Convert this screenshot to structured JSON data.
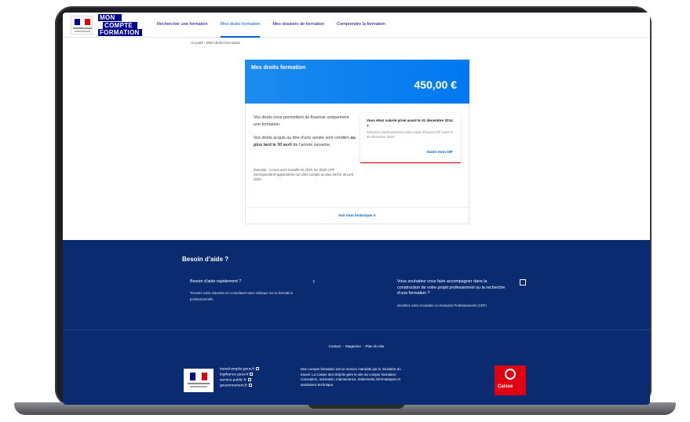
{
  "colors": {
    "brand_blue": "#000091",
    "link_blue": "#0063cb",
    "card_blue": "#0078f0",
    "footer_navy": "#0a2b70",
    "marianne_red": "#e1000f"
  },
  "header": {
    "logo_lines": [
      "MON",
      "COMPTE",
      "FORMATION"
    ],
    "nav": [
      {
        "label": "Rechercher une formation"
      },
      {
        "label": "Mes droits formation"
      },
      {
        "label": "Mes dossiers de formation"
      },
      {
        "label": "Comprendre la formation"
      }
    ],
    "active_nav_index": 1
  },
  "breadcrumb": {
    "text": "Accueil  ›  Mes droits formation"
  },
  "rights": {
    "title": "Mes droits formation",
    "amount": "450,00 €",
    "para1": "Vos droits vous permettent de financer uniquement une formation.",
    "para2_pre": "Vos droits acquis au titre d’une année sont crédités ",
    "para2_bold": "au plus tard le 30 avril",
    "para2_post": " de l’année suivante.",
    "example": "Exemple : si vous avez travaillé en 2019, les droits CPF correspondants apparaitront sur votre compte au plus tard le 30 avril 2020.",
    "dif_title": "Vous étiez salarié privé avant le 31 décembre 2014 ?",
    "dif_desc": "Saisissez impérativement votre solde d’heures DIF avant le 31 décembre 2020.",
    "dif_link": "Saisir mon DIF",
    "history_link": "Voir mon historique ∨"
  },
  "help": {
    "title": "Besoin d’aide ?",
    "card1_title": "Besoin d’aide rapidement ?",
    "card1_desc": "Trouvez votre réponse en consultant notre rubrique sur la formation professionnelle",
    "card1_arrow": "›",
    "card2_title": "Vous souhaitez vous faire accompagner dans la construction de votre projet professionnel ou la recherche d’une formation ?",
    "card2_desc": "Identifiez votre Conseiller en Evolution Professionnelle (CEP)"
  },
  "footer": {
    "links": [
      "Contact",
      "Magazine",
      "Plan du site"
    ],
    "separator": "-",
    "gov_links": [
      "travail-emploi.gouv.fr",
      "legifrance.gouv.fr",
      "service-public.fr",
      "gouvernement.fr"
    ],
    "description": "Mon compte formation est un service mandaté par le ministère du travail. La Caisse des Dépôts gère le site du compte formation : conception, animation, maintenance, traitements informatiques et assistance technique.",
    "cdc_label": "Caisse"
  }
}
